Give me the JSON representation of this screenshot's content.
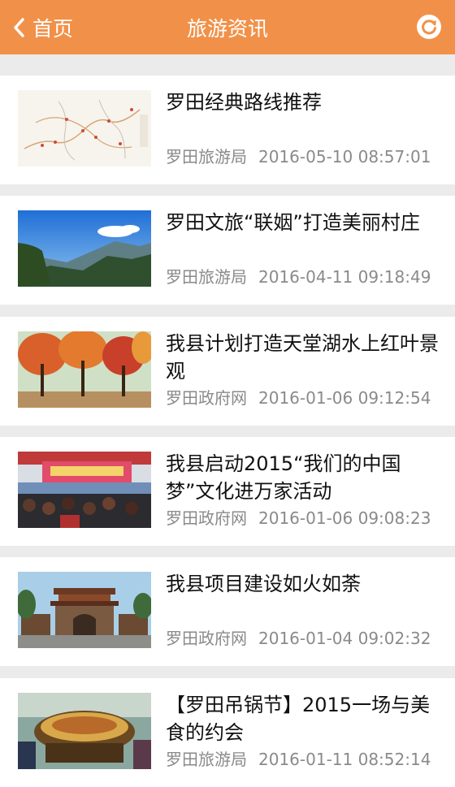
{
  "header": {
    "back_label": "首页",
    "title": "旅游资讯",
    "back_icon": "chevron-left-icon",
    "refresh_icon": "refresh-icon",
    "bar_color": "#f19149"
  },
  "news": [
    {
      "title": "罗田经典路线推荐",
      "source": "罗田旅游局",
      "time": "2016-05-10 08:57:01",
      "image": "route-map-image"
    },
    {
      "title": "罗田文旅“联姻”打造美丽村庄",
      "source": "罗田旅游局",
      "time": "2016-04-11 09:18:49",
      "image": "mountain-landscape-image"
    },
    {
      "title": "我县计划打造天堂湖水上红叶景观",
      "source": "罗田政府网",
      "time": "2016-01-06 09:12:54",
      "image": "red-leaf-trees-image"
    },
    {
      "title": "我县启动2015“我们的中国梦”文化进万家活动",
      "source": "罗田政府网",
      "time": "2016-01-06 09:08:23",
      "image": "cultural-event-stage-image"
    },
    {
      "title": "我县项目建设如火如荼",
      "source": "罗田政府网",
      "time": "2016-01-04 09:02:32",
      "image": "construction-gate-image"
    },
    {
      "title": "【罗田吊锅节】2015一场与美食的约会",
      "source": "罗田旅游局",
      "time": "2016-01-11 08:52:14",
      "image": "hotpot-festival-image"
    }
  ]
}
